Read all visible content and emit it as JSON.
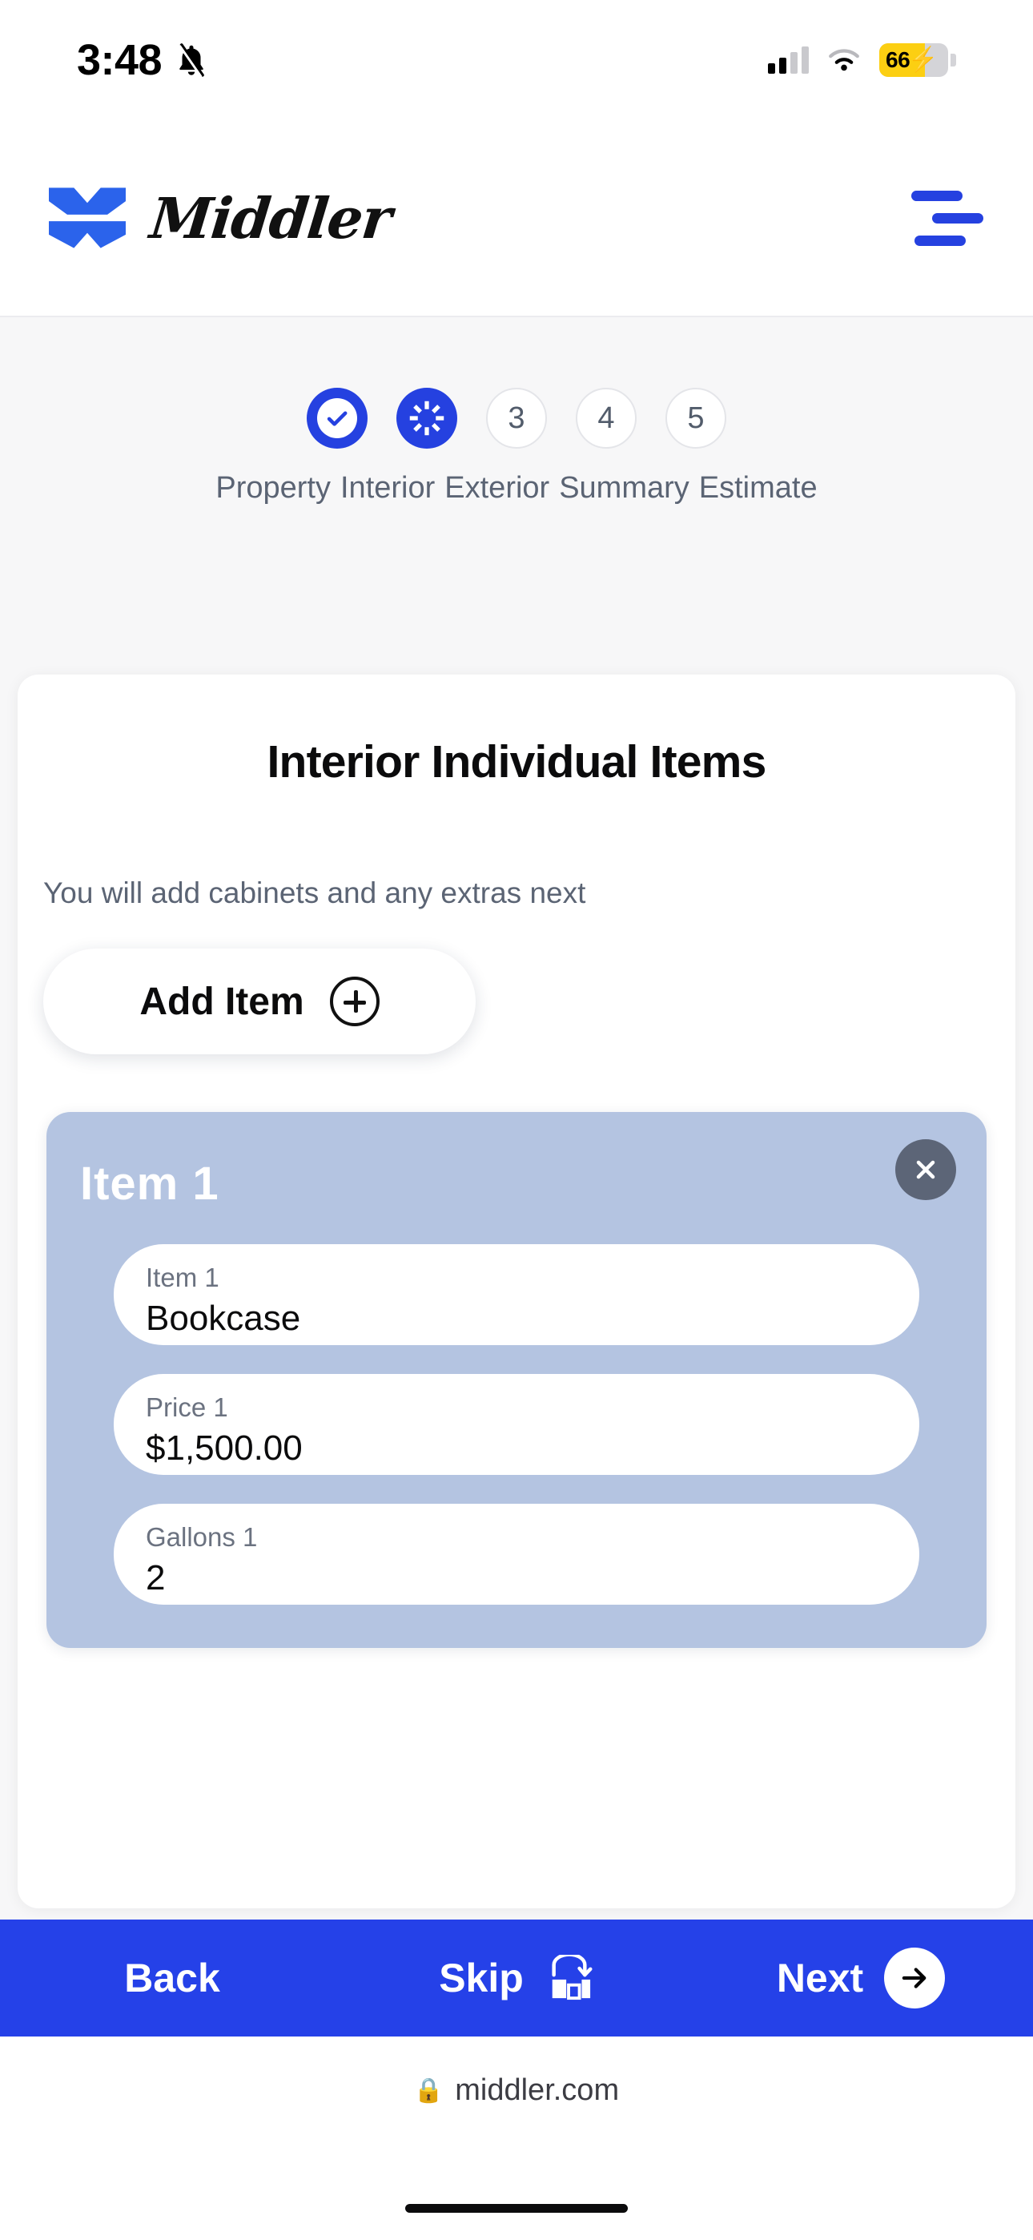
{
  "status_bar": {
    "time": "3:48",
    "bell_icon": "bell-muted-icon",
    "signal_icon": "cellular-signal-icon",
    "wifi_icon": "wifi-icon",
    "battery_level": "66",
    "battery_charging_glyph": "⚡",
    "battery_fill_color": "#FCCF12"
  },
  "header": {
    "logo_mark": "middler-logo-mark",
    "brand_name": "Middler",
    "menu_icon": "hamburger-menu-icon",
    "brand_blue": "#2541E0"
  },
  "stepper": {
    "steps": [
      {
        "number": "1",
        "label": "Property",
        "state": "done"
      },
      {
        "number": "2",
        "label": "Interior",
        "state": "active"
      },
      {
        "number": "3",
        "label": "Exterior",
        "state": "pending"
      },
      {
        "number": "4",
        "label": "Summary",
        "state": "pending"
      },
      {
        "number": "5",
        "label": "Estimate",
        "state": "pending"
      }
    ]
  },
  "main": {
    "title": "Interior Individual Items",
    "subtitle": "You will add cabinets and any extras next",
    "add_item_label": "Add Item",
    "add_item_icon": "plus-circle-icon"
  },
  "item_card": {
    "heading": "Item 1",
    "close_icon": "close-x-icon",
    "card_color": "#B4C4E1",
    "fields": [
      {
        "label": "Item 1",
        "value": "Bookcase"
      },
      {
        "label": "Price 1",
        "value": "$1,500.00"
      },
      {
        "label": "Gallons 1",
        "value": "2"
      }
    ]
  },
  "bottom_nav": {
    "back_label": "Back",
    "skip_label": "Skip",
    "skip_icon": "skip-forward-icon",
    "next_label": "Next",
    "next_icon": "arrow-right-icon",
    "bar_color": "#2541E8"
  },
  "browser_bar": {
    "lock_icon": "lock-icon",
    "url": "middler.com"
  }
}
